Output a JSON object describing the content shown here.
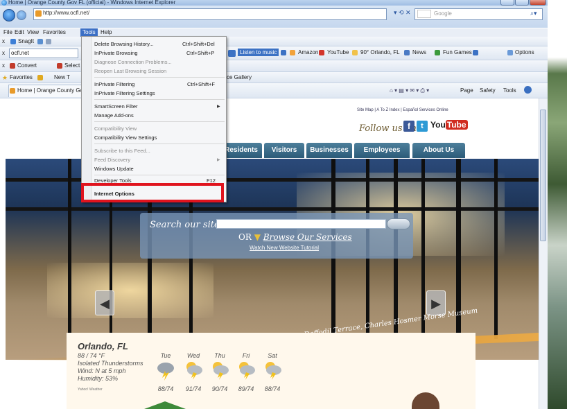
{
  "window": {
    "title": "Home | Orange County Gov FL (official) - Windows Internet Explorer",
    "url": "http://www.ocfl.net/",
    "search_placeholder": "Google"
  },
  "menubar": [
    "File",
    "Edit",
    "View",
    "Favorites",
    "Tools",
    "Help"
  ],
  "toolbar1": {
    "snagit": "SnagIt",
    "close": "x"
  },
  "toolbar2": {
    "address_value": "ocfl.net",
    "listen": "Listen to music",
    "links": [
      "Amazon",
      "YouTube",
      "90° Orlando, FL",
      "News",
      "Fun Games"
    ],
    "options": "Options"
  },
  "toolbar3": {
    "convert": "Convert",
    "select": "Select"
  },
  "favbar": {
    "favorites": "Favorites",
    "new_tab": "New T",
    "gallery": "ce Gallery",
    "tab_label": "Home | Orange County Gov",
    "page": "Page",
    "safety": "Safety",
    "tools": "Tools"
  },
  "dropdown": {
    "items": [
      {
        "label": "Delete Browsing History...",
        "shortcut": "Ctrl+Shift+Del",
        "enabled": true
      },
      {
        "label": "InPrivate Browsing",
        "shortcut": "Ctrl+Shift+P",
        "enabled": true
      },
      {
        "label": "Diagnose Connection Problems...",
        "shortcut": "",
        "enabled": false
      },
      {
        "label": "Reopen Last Browsing Session",
        "shortcut": "",
        "enabled": false
      },
      {
        "label": "InPrivate Filtering",
        "shortcut": "Ctrl+Shift+F",
        "enabled": true
      },
      {
        "label": "InPrivate Filtering Settings",
        "shortcut": "",
        "enabled": true
      },
      {
        "label": "SmartScreen Filter",
        "shortcut": "",
        "enabled": true
      },
      {
        "label": "Manage Add-ons",
        "shortcut": "",
        "enabled": true
      },
      {
        "label": "Compatibility View",
        "shortcut": "",
        "enabled": false
      },
      {
        "label": "Compatibility View Settings",
        "shortcut": "",
        "enabled": true
      },
      {
        "label": "Subscribe to this Feed...",
        "shortcut": "",
        "enabled": false
      },
      {
        "label": "Feed Discovery",
        "shortcut": "",
        "enabled": false
      },
      {
        "label": "Windows Update",
        "shortcut": "",
        "enabled": true
      },
      {
        "label": "Developer Tools",
        "shortcut": "F12",
        "enabled": true
      },
      {
        "label": "Internet Options",
        "shortcut": "",
        "enabled": true
      }
    ]
  },
  "site": {
    "top_links": "Site Map  |  A To Z Index  |  Español    Services Online",
    "follow_us": "Follow us on",
    "nav_tabs": [
      "Residents",
      "Visitors",
      "Businesses",
      "Employees",
      "About Us"
    ],
    "search_label": "Search our site",
    "or_text": "OR",
    "browse_text": "Browse Our Services",
    "tutorial": "Watch New Website Tutorial",
    "caption": "Daffodil Terrace, Charles Hosmer Morse Museum"
  },
  "weather": {
    "city": "Orlando, FL",
    "current": "88 / 74 °F",
    "condition": "Isolated Thunderstorms",
    "wind": "Wind: N at 5 mph",
    "humidity": "Humidity: 53%",
    "credit": "Yahoo! Weather",
    "days": [
      "Tue",
      "Wed",
      "Thu",
      "Fri",
      "Sat"
    ],
    "temps": [
      "88/74",
      "91/74",
      "90/74",
      "89/74",
      "88/74"
    ]
  },
  "colors": {
    "highlight": "#e0141e",
    "nav_tab": "#2c5b79",
    "menu_selected": "#3b6fc5"
  }
}
